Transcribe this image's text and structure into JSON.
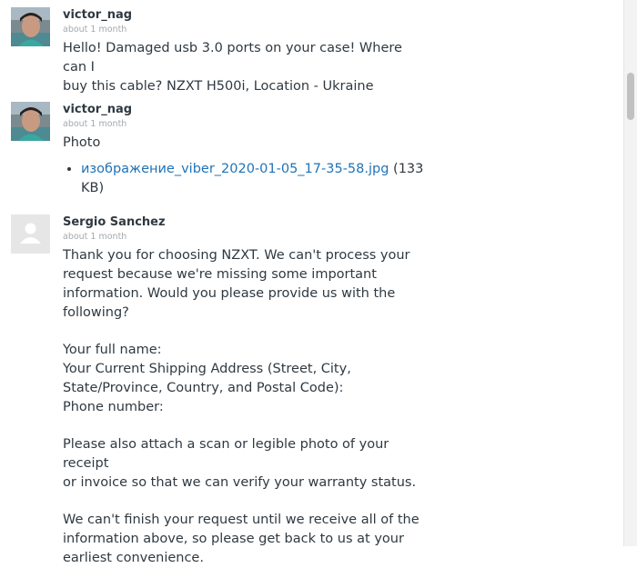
{
  "comments": [
    {
      "author": "victor_nag",
      "time": "about 1 month",
      "avatar": "user-photo-avatar",
      "lines": [
        "Hello! Damaged usb 3.0 ports on your case! Where can I",
        "buy this cable? NZXT H500i, Location - Ukraine"
      ]
    },
    {
      "author": "victor_nag",
      "time": "about 1 month",
      "avatar": "user-photo-avatar",
      "lines": [
        "Photo"
      ],
      "attachment": {
        "name": "изображение_viber_2020-01-05_17-35-58.jpg",
        "size_line1": "(133",
        "size_line2": "KB)"
      }
    },
    {
      "author": "Sergio Sanchez",
      "time": "about 1 month",
      "avatar": "default-person-avatar",
      "paragraphs": [
        [
          "Thank you for choosing NZXT. We can't process your",
          "request because we're missing some important",
          "information. Would you please provide us with the",
          "following?"
        ],
        [
          "Your full name:",
          "Your Current Shipping Address (Street, City,",
          "State/Province, Country, and Postal Code):",
          "Phone number:"
        ],
        [
          "Please also attach a scan or legible photo of your receipt",
          "or invoice so that we can verify your warranty status."
        ],
        [
          "We can't finish your request until we receive all of the",
          "information above, so please get back to us at your",
          "earliest convenience."
        ]
      ]
    }
  ]
}
